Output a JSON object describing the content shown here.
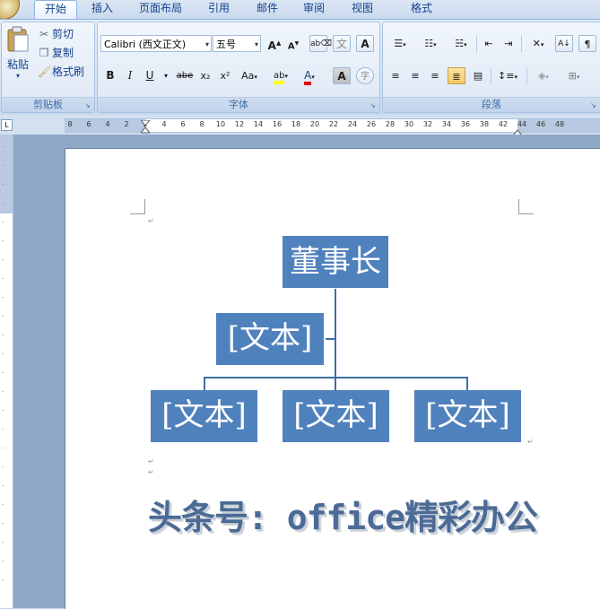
{
  "tabs": [
    {
      "label": "开始",
      "active": true
    },
    {
      "label": "插入"
    },
    {
      "label": "页面布局"
    },
    {
      "label": "引用"
    },
    {
      "label": "邮件"
    },
    {
      "label": "审阅"
    },
    {
      "label": "视图"
    },
    {
      "label": "格式"
    }
  ],
  "clipboard": {
    "paste_label": "粘贴",
    "cut_label": "剪切",
    "copy_label": "复制",
    "format_painter_label": "格式刷",
    "group_label": "剪贴板"
  },
  "font": {
    "font_name": "Calibri (西文正文)",
    "font_size": "五号",
    "grow_label": "A",
    "shrink_label": "A",
    "bold": "B",
    "italic": "I",
    "underline": "U",
    "strike": "abe",
    "subscript": "x₂",
    "superscript": "x²",
    "change_case": "Aa",
    "highlight": "ab",
    "font_color": "A",
    "char_shading": "A",
    "enclose_char": "字",
    "phonetic": "文",
    "clear_format": "A",
    "group_label": "字体"
  },
  "paragraph": {
    "group_label": "段落"
  },
  "ruler": {
    "ticks": [
      "8",
      "6",
      "4",
      "2",
      "2",
      "4",
      "6",
      "8",
      "10",
      "12",
      "14",
      "16",
      "18",
      "20",
      "22",
      "24",
      "26",
      "28",
      "30",
      "32",
      "34",
      "36",
      "38",
      "42",
      "44",
      "46",
      "48"
    ]
  },
  "orgchart": {
    "top": "董事长",
    "assistant": "[文本]",
    "children": [
      "[文本]",
      "[文本]",
      "[文本]"
    ]
  },
  "wordart": {
    "text": "头条号: office精彩办公"
  },
  "colors": {
    "node_fill": "#4f81bd",
    "connector": "#3f6ea5",
    "wordart": "#4b6b96"
  }
}
